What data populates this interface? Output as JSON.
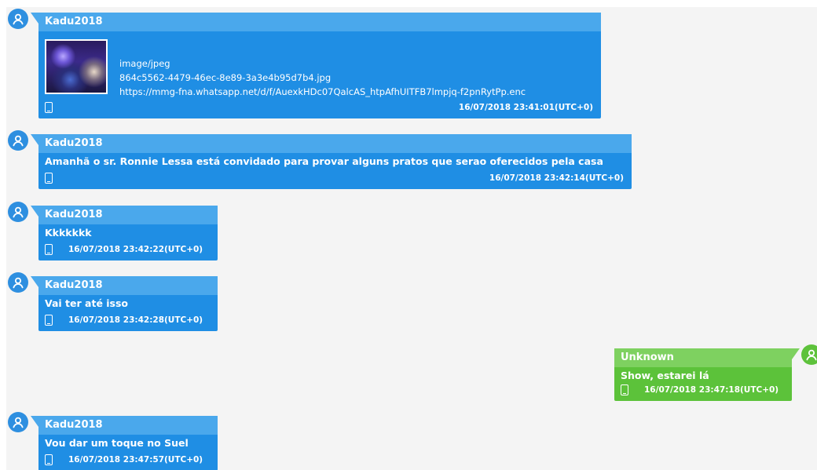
{
  "colors": {
    "incoming_bubble": "#1f8ee4",
    "incoming_header": "#4aa8ec",
    "outgoing_bubble": "#5cc23a",
    "outgoing_header": "#7ed160",
    "background": "#f4f4f4"
  },
  "messages": [
    {
      "sender": "Kadu2018",
      "direction": "incoming",
      "attachment": {
        "mime": "image/jpeg",
        "filename": "864c5562-4479-46ec-8e89-3a3e4b95d7b4.jpg",
        "url": "https://mmg-fna.whatsapp.net/d/f/AuexkHDc07QalcAS_htpAfhUITFB7lmpjq-f2pnRytPp.enc"
      },
      "timestamp": "16/07/2018 23:41:01(UTC+0)",
      "icon": "phone-icon"
    },
    {
      "sender": "Kadu2018",
      "direction": "incoming",
      "text": "Amanhã o sr. Ronnie Lessa está convidado para provar alguns pratos que serao oferecidos pela casa",
      "timestamp": "16/07/2018 23:42:14(UTC+0)",
      "icon": "phone-icon"
    },
    {
      "sender": "Kadu2018",
      "direction": "incoming",
      "text": "Kkkkkkk",
      "timestamp": "16/07/2018 23:42:22(UTC+0)",
      "icon": "phone-icon"
    },
    {
      "sender": "Kadu2018",
      "direction": "incoming",
      "text": "Vai ter até isso",
      "timestamp": "16/07/2018 23:42:28(UTC+0)",
      "icon": "phone-icon"
    },
    {
      "sender": "Unknown",
      "direction": "outgoing",
      "text": "Show, estarei lá",
      "timestamp": "16/07/2018 23:47:18(UTC+0)",
      "icon": "phone-icon"
    },
    {
      "sender": "Kadu2018",
      "direction": "incoming",
      "text": "Vou dar um toque no Suel",
      "timestamp": "16/07/2018 23:47:57(UTC+0)",
      "icon": "phone-icon"
    }
  ]
}
